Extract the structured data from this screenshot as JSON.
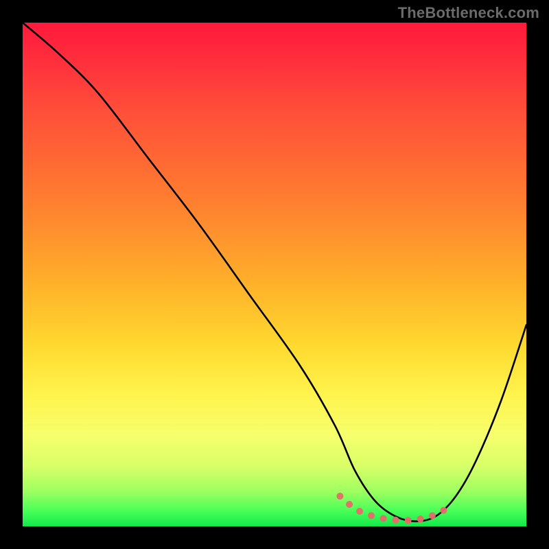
{
  "watermark": "TheBottleneck.com",
  "chart_data": {
    "type": "line",
    "title": "",
    "xlabel": "",
    "ylabel": "",
    "xlim": [
      0,
      100
    ],
    "ylim": [
      0,
      100
    ],
    "grid": false,
    "legend": false,
    "series": [
      {
        "name": "bottleneck-curve",
        "color": "#000000",
        "x": [
          0,
          7,
          15,
          25,
          35,
          45,
          55,
          62,
          66,
          70,
          74,
          78,
          82,
          86,
          90,
          95,
          100
        ],
        "values": [
          100,
          94,
          86,
          73,
          60,
          46,
          32,
          20,
          11,
          5,
          2,
          1,
          2,
          6,
          13,
          25,
          40
        ]
      },
      {
        "name": "acceptable-range-markers",
        "color": "#e86a6a",
        "type": "scatter",
        "x": [
          63,
          66,
          69,
          72,
          75,
          78,
          81,
          84
        ],
        "values": [
          6,
          3.5,
          2.2,
          1.5,
          1.2,
          1.3,
          2.0,
          3.4
        ]
      }
    ],
    "background_gradient": {
      "top": "#ff1a3c",
      "mid": "#ffd92f",
      "bottom": "#12e84a"
    }
  }
}
